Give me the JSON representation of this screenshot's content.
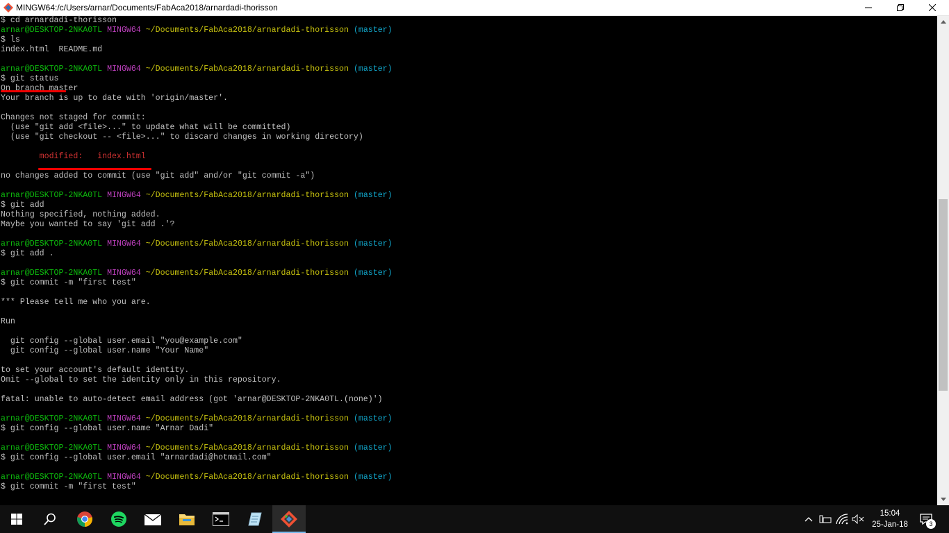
{
  "window": {
    "title": "MINGW64:/c/Users/arnar/Documents/FabAca2018/arnardadi-thorisson",
    "icon": "git-bash-icon",
    "controls": [
      "minimize-icon",
      "restore-icon",
      "close-icon"
    ]
  },
  "prompt": {
    "user": "arnar@DESKTOP-2NKA0TL",
    "shell": "MINGW64",
    "path": "~/Documents/FabAca2018/arnardadi-thorisson",
    "branch": "(master)"
  },
  "terminal": {
    "lines": [
      "$ cd arnardadi-thorisson",
      "",
      "$ ls",
      "index.html  README.md",
      "",
      "",
      "$ git status",
      "On branch master",
      "Your branch is up to date with 'origin/master'.",
      "",
      "Changes not staged for commit:",
      "  (use \"git add <file>...\" to update what will be committed)",
      "  (use \"git checkout -- <file>...\" to discard changes in working directory)",
      "",
      "        modified:   index.html",
      "",
      "no changes added to commit (use \"git add\" and/or \"git commit -a\")",
      "",
      "",
      "$ git add",
      "Nothing specified, nothing added.",
      "Maybe you wanted to say 'git add .'?",
      "",
      "",
      "$ git add .",
      "",
      "",
      "$ git commit -m \"first test\"",
      "",
      "*** Please tell me who you are.",
      "",
      "Run",
      "",
      "  git config --global user.email \"you@example.com\"",
      "  git config --global user.name \"Your Name\"",
      "",
      "to set your account's default identity.",
      "Omit --global to set the identity only in this repository.",
      "",
      "fatal: unable to auto-detect email address (got 'arnar@DESKTOP-2NKA0TL.(none)')",
      "",
      "",
      "$ git config --global user.name \"Arnar Dadi\"",
      "",
      "",
      "$ git config --global user.email \"arnardadi@hotmail.com\"",
      "",
      "",
      "$ git commit -m \"first test\""
    ],
    "prompt_line_indices": [
      1,
      5,
      18,
      23,
      26,
      41,
      44,
      47
    ],
    "red_line_indices": [
      14
    ],
    "annotations": [
      "git-status-underline",
      "modified-index-underline"
    ]
  },
  "taskbar": {
    "apps": [
      "windows-start-icon",
      "search-icon",
      "chrome-icon",
      "spotify-icon",
      "mail-icon",
      "file-explorer-icon",
      "command-prompt-icon",
      "notepad-icon",
      "git-bash-icon"
    ],
    "active_app": "git-bash-icon",
    "tray": [
      "chevron-up-icon",
      "network-icon",
      "wifi-icon",
      "volume-muted-icon"
    ],
    "time": "15:04",
    "date": "25-Jan-18",
    "notification_count": "3"
  },
  "colors": {
    "prompt_user": "#0dbc0d",
    "prompt_shell": "#bc3fbc",
    "prompt_path": "#c8c30f",
    "prompt_branch": "#11a8cd",
    "text": "#c0c0c0",
    "modified": "#cd3131",
    "underline": "#e00000"
  }
}
